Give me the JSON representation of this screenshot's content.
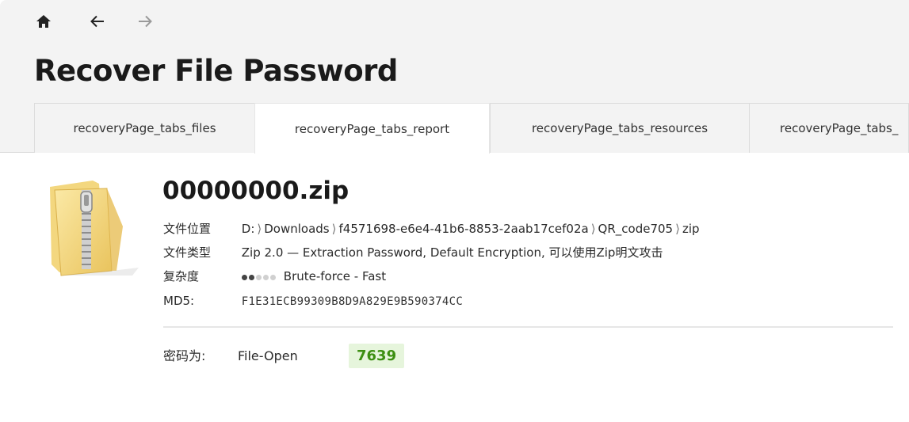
{
  "nav": {
    "home_icon": "home-icon",
    "back_icon": "arrow-left-icon",
    "forward_icon": "arrow-right-icon"
  },
  "page": {
    "title": "Recover File Password"
  },
  "tabs": [
    {
      "label": "recoveryPage_tabs_files",
      "active": false
    },
    {
      "label": "recoveryPage_tabs_report",
      "active": true
    },
    {
      "label": "recoveryPage_tabs_resources",
      "active": false
    },
    {
      "label": "recoveryPage_tabs_",
      "active": false
    }
  ],
  "file": {
    "icon": "zip-folder-icon",
    "name": "00000000.zip",
    "location_label": "文件位置",
    "location_path": [
      "D:",
      "Downloads",
      "f4571698-e6e4-41b6-8853-2aab17cef02a",
      "QR_code705",
      "zip"
    ],
    "type_label": "文件类型",
    "type_value": "Zip 2.0 — Extraction Password, Default Encryption, 可以使用Zip明文攻击",
    "complexity_label": "复杂度",
    "complexity_level": 2,
    "complexity_max": 5,
    "complexity_text": "Brute-force - Fast",
    "md5_label": "MD5:",
    "md5_value": "F1E31ECB99309B8D9A829E9B590374CC"
  },
  "result": {
    "label": "密码为:",
    "type": "File-Open",
    "password": "7639"
  },
  "colors": {
    "password_bg": "#e6f5dc",
    "password_fg": "#3d8f12",
    "dot_filled": "#444444",
    "dot_empty": "#d0d0d0"
  }
}
